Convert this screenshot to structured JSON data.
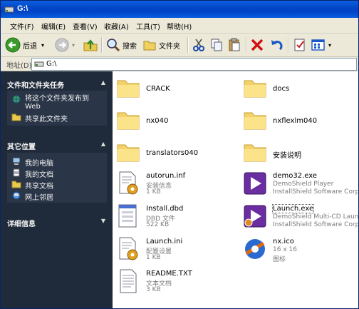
{
  "window": {
    "title": "G:\\"
  },
  "menu": [
    "文件(F)",
    "编辑(E)",
    "查看(V)",
    "收藏(A)",
    "工具(T)",
    "帮助(H)"
  ],
  "toolbar": {
    "back": "后退",
    "search": "搜索",
    "folders": "文件夹"
  },
  "address": {
    "label": "地址(D)",
    "value": "G:\\"
  },
  "left_panel": {
    "tasks": {
      "title": "文件和文件夹任务",
      "items": [
        "将这个文件夹发布到",
        "Web",
        "共享此文件夹"
      ]
    },
    "places": {
      "title": "其它位置",
      "items": [
        "我的电脑",
        "我的文档",
        "共享文档",
        "网上邻居"
      ]
    },
    "details": {
      "title": "详细信息"
    }
  },
  "files": [
    {
      "name": "CRACK",
      "type": "folder"
    },
    {
      "name": "docs",
      "type": "folder"
    },
    {
      "name": "nx040",
      "type": "folder"
    },
    {
      "name": "nxflexlm040",
      "type": "folder"
    },
    {
      "name": "translators040",
      "type": "folder"
    },
    {
      "name": "安装说明",
      "type": "folder"
    },
    {
      "name": "autorun.inf",
      "line2": "安装信息",
      "line3": "1 KB",
      "type": "setup"
    },
    {
      "name": "demo32.exe",
      "line2": "DemoShield Player",
      "line3": "InstallShield Software Corpora...",
      "type": "demo"
    },
    {
      "name": "Install.dbd",
      "line2": "DBD 文件",
      "line3": "522 KB",
      "type": "dbd"
    },
    {
      "name": "Launch.exe",
      "line2": "DemoShield Multi-CD Launch",
      "line3": "InstallShield Software Corpora...",
      "type": "launch"
    },
    {
      "name": "Launch.ini",
      "line2": "配置设置",
      "line3": "1 KB",
      "type": "setup"
    },
    {
      "name": "nx.ico",
      "line2": "16 x 16",
      "line3": "图标",
      "type": "ico"
    },
    {
      "name": "README.TXT",
      "line2": "文本文档",
      "line3": "3 KB",
      "type": "txt"
    }
  ]
}
